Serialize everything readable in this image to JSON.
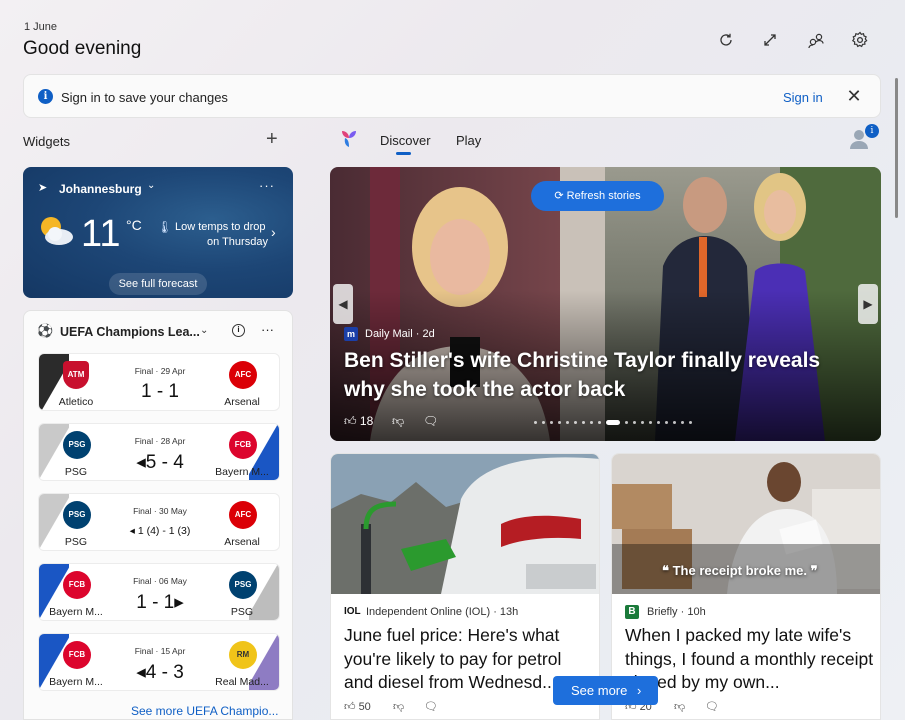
{
  "header": {
    "date": "1 June",
    "greeting": "Good evening",
    "icons": [
      "refresh-icon",
      "expand-icon",
      "people-icon",
      "gear-icon"
    ]
  },
  "banner": {
    "message": "Sign in to save your changes",
    "signin_label": "Sign in"
  },
  "widgets": {
    "label": "Widgets",
    "weather": {
      "location": "Johannesburg",
      "temperature": "11",
      "unit": "°C",
      "forecast_line1": "Low temps to drop",
      "forecast_line2": "on Thursday",
      "full_forecast_label": "See full forecast"
    },
    "ucl": {
      "title": "UEFA Champions Lea...",
      "see_more": "See more UEFA Champio...",
      "matches": [
        {
          "home": "Atletico",
          "away": "Arsenal",
          "meta": "Final · 29 Apr",
          "score": "1 - 1"
        },
        {
          "home": "PSG",
          "away": "Bayern M...",
          "meta": "Final · 28 Apr",
          "score": "◂5 - 4"
        },
        {
          "home": "PSG",
          "away": "Arsenal",
          "meta": "Final · 30 May",
          "score": "◂ 1 (4) - 1 (3)"
        },
        {
          "home": "Bayern M...",
          "away": "PSG",
          "meta": "Final · 06 May",
          "score": "1 - 1▸"
        },
        {
          "home": "Bayern M...",
          "away": "Real Mad...",
          "meta": "Final · 15 Apr",
          "score": "◂4 - 3"
        }
      ]
    }
  },
  "feed": {
    "tabs": [
      "Discover",
      "Play"
    ],
    "avatar_badge": "i",
    "hero": {
      "refresh_label": "Refresh stories",
      "source": "Daily Mail · 2d",
      "source_logo": "m",
      "headline": "Ben Stiller's wife Christine Taylor finally reveals why she took the actor back",
      "likes": "18"
    },
    "cards": [
      {
        "source": "Independent Online (IOL) · 13h",
        "source_logo": "IOL",
        "title": "June fuel price: Here's what you're likely to pay for petrol and diesel from Wednesd...",
        "likes": "50"
      },
      {
        "source": "Briefly · 10h",
        "source_logo": "B",
        "quote": "The receipt broke me.",
        "title": "When I packed my late wife's things, I found a monthly receipt signed by my own...",
        "likes": "20"
      }
    ],
    "see_more_label": "See more"
  }
}
